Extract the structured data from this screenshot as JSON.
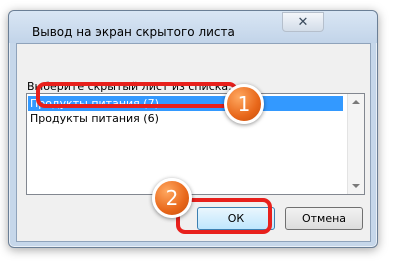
{
  "dialog": {
    "title": "Вывод на экран скрытого листа",
    "close_label": "✕",
    "prompt": "Выберите скрытый лист из списка:",
    "list_items": [
      {
        "label": "Продукты питания (7)",
        "selected": true
      },
      {
        "label": "Продукты питания (6)",
        "selected": false
      }
    ],
    "ok_label": "ОК",
    "cancel_label": "Отмена"
  },
  "annotations": [
    {
      "label": "1"
    },
    {
      "label": "2"
    }
  ],
  "colors": {
    "selection": "#3399ff",
    "highlight": "#e8201c",
    "badge": "#e8671a"
  },
  "icons": {
    "close": "close-icon",
    "scroll_up": "scroll-up-arrow-icon",
    "scroll_down": "scroll-down-arrow-icon"
  }
}
